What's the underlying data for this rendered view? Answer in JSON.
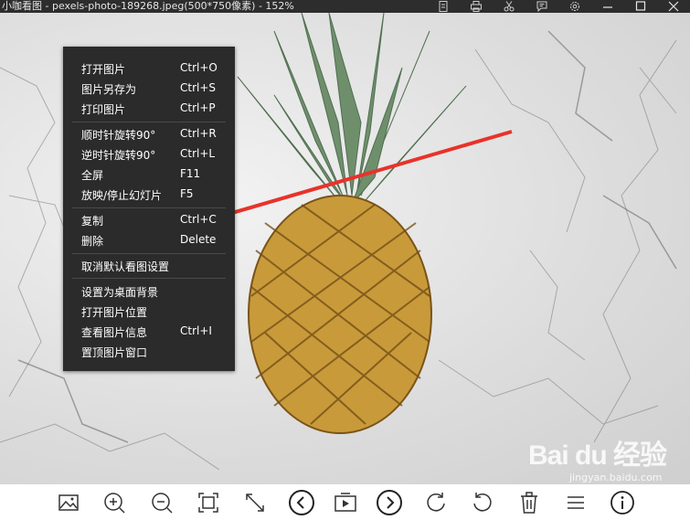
{
  "window": {
    "title": "小咖看图 - pexels-photo-189268.jpeg(500*750像素) - 152%"
  },
  "titlebar_icons": [
    "document-icon",
    "print-icon",
    "scissors-icon",
    "feedback-icon",
    "settings-icon",
    "minimize-icon",
    "maximize-icon",
    "close-icon"
  ],
  "context_menu": {
    "items": [
      {
        "label": "打开图片",
        "shortcut": "Ctrl+O"
      },
      {
        "label": "图片另存为",
        "shortcut": "Ctrl+S"
      },
      {
        "label": "打印图片",
        "shortcut": "Ctrl+P"
      },
      {
        "label": "顺时针旋转90°",
        "shortcut": "Ctrl+R"
      },
      {
        "label": "逆时针旋转90°",
        "shortcut": "Ctrl+L"
      },
      {
        "label": "全屏",
        "shortcut": "F11"
      },
      {
        "label": "放映/停止幻灯片",
        "shortcut": "F5"
      },
      {
        "label": "复制",
        "shortcut": "Ctrl+C"
      },
      {
        "label": "删除",
        "shortcut": "Delete"
      },
      {
        "label": "取消默认看图设置",
        "shortcut": ""
      },
      {
        "label": "设置为桌面背景",
        "shortcut": ""
      },
      {
        "label": "打开图片位置",
        "shortcut": ""
      },
      {
        "label": "查看图片信息",
        "shortcut": "Ctrl+I"
      },
      {
        "label": "置顶图片窗口",
        "shortcut": ""
      }
    ]
  },
  "watermark": {
    "logo": "Bai du 经验",
    "url": "jingyan.baidu.com"
  },
  "bottom_toolbar": [
    "image-icon",
    "zoom-in-icon",
    "zoom-out-icon",
    "fit-screen-icon",
    "actual-size-icon",
    "previous-icon",
    "slideshow-icon",
    "next-icon",
    "rotate-clockwise-icon",
    "rotate-counterclockwise-icon",
    "delete-icon",
    "menu-icon",
    "info-icon"
  ],
  "colors": {
    "titlebar": "#2d2d2d",
    "menu_bg": "#2b2b2b",
    "arrow": "#e8332a",
    "marble": "#dcdcdc"
  }
}
